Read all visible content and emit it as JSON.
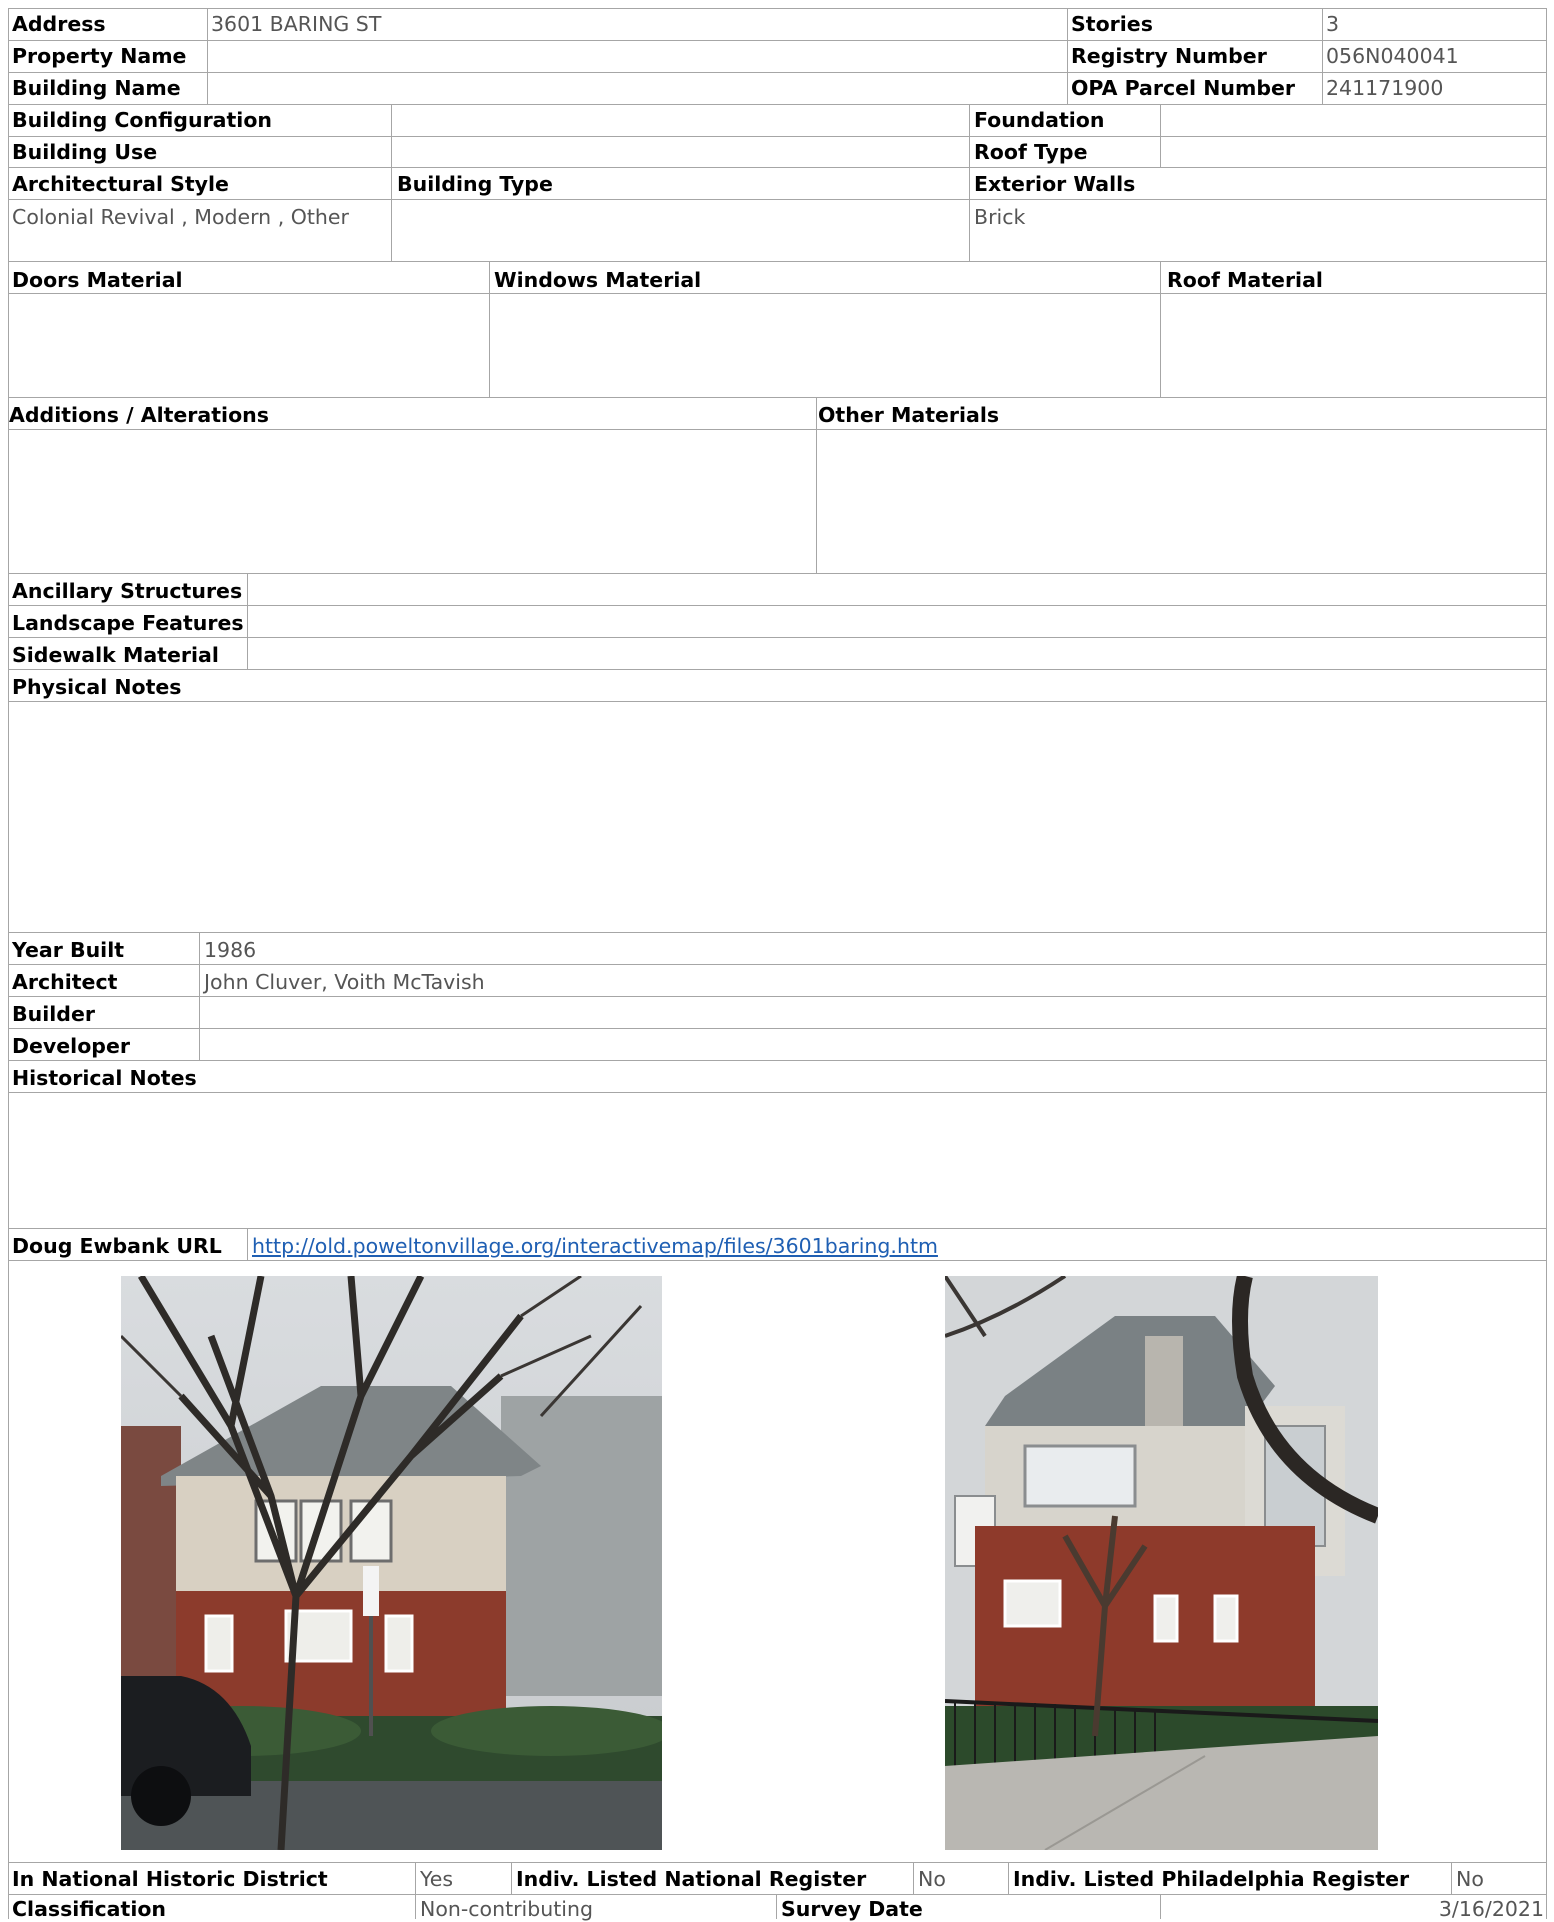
{
  "labels": {
    "address": "Address",
    "stories": "Stories",
    "property_name": "Property Name",
    "registry_number": "Registry Number",
    "building_name": "Building Name",
    "opa_parcel_number": "OPA Parcel Number",
    "building_configuration": "Building Configuration",
    "foundation": "Foundation",
    "building_use": "Building Use",
    "roof_type": "Roof Type",
    "architectural_style": "Architectural Style",
    "building_type": "Building Type",
    "exterior_walls": "Exterior Walls",
    "doors_material": "Doors Material",
    "windows_material": "Windows Material",
    "roof_material": "Roof Material",
    "additions_alterations": "Additions / Alterations",
    "other_materials": "Other Materials",
    "ancillary_structures": "Ancillary Structures",
    "landscape_features": "Landscape Features",
    "sidewalk_material": "Sidewalk Material",
    "physical_notes": "Physical Notes",
    "year_built": "Year Built",
    "architect": "Architect",
    "builder": "Builder",
    "developer": "Developer",
    "historical_notes": "Historical Notes",
    "doug_ewbank_url": "Doug Ewbank URL",
    "in_national_historic_district": "In National Historic District",
    "indiv_listed_national_register": "Indiv. Listed National Register",
    "indiv_listed_philadelphia_register": "Indiv. Listed Philadelphia Register",
    "classification": "Classification",
    "survey_date": "Survey Date"
  },
  "values": {
    "address": "3601 BARING ST",
    "stories": "3",
    "property_name": "",
    "registry_number": "056N040041",
    "building_name": "",
    "opa_parcel_number": "241171900",
    "building_configuration": "",
    "foundation": "",
    "building_use": "",
    "roof_type": "",
    "architectural_style": "Colonial Revival , Modern , Other",
    "building_type": "",
    "exterior_walls": "Brick",
    "year_built": "1986",
    "architect": "John Cluver, Voith McTavish",
    "builder": "",
    "developer": "",
    "doug_ewbank_url": "http://old.poweltonvillage.org/interactivemap/files/3601baring.htm",
    "in_national_historic_district": "Yes",
    "indiv_listed_national_register": "No",
    "indiv_listed_philadelphia_register": "No",
    "classification": "Non-contributing",
    "survey_date": "3/16/2021"
  },
  "colors": {
    "grid_line": "#a6a6a6",
    "label_text": "#000000",
    "value_text": "#555555",
    "link": "#1f5fb3"
  }
}
